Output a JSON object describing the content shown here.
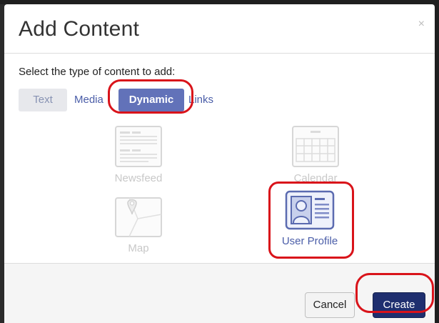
{
  "dialog": {
    "title": "Add Content",
    "close_glyph": "×",
    "prompt": "Select the type of content to add:"
  },
  "tabs": [
    {
      "label": "Text",
      "state": "disabled"
    },
    {
      "label": "Media",
      "state": "link"
    },
    {
      "label": "Dynamic",
      "state": "active"
    },
    {
      "label": "Links",
      "state": "link"
    }
  ],
  "content_types": [
    {
      "label": "Newsfeed",
      "icon": "newsfeed-icon",
      "state": "disabled"
    },
    {
      "label": "Calendar",
      "icon": "calendar-icon",
      "state": "disabled"
    },
    {
      "label": "Map",
      "icon": "map-pin-icon",
      "state": "disabled"
    },
    {
      "label": "User Profile",
      "icon": "user-profile-icon",
      "state": "enabled"
    }
  ],
  "footer": {
    "cancel_label": "Cancel",
    "create_label": "Create"
  },
  "colors": {
    "accent": "#6272b9",
    "primary_button": "#1f2f6f",
    "highlight_ring": "#d9131a",
    "disabled_text": "#c8c8c8"
  }
}
